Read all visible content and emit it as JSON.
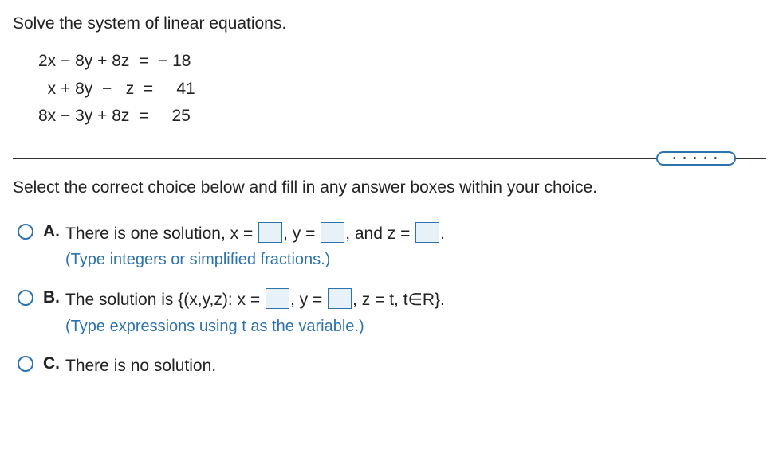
{
  "questionPrompt": "Solve the system of linear equations.",
  "equations": {
    "row1": "2x − 8y + 8z  =  − 18",
    "row2": "  x + 8y  −   z  =     41",
    "row3": "8x − 3y + 8z  =     25"
  },
  "selectPrompt": "Select the correct choice below and fill in any answer boxes within your choice.",
  "choices": {
    "A": {
      "letter": "A.",
      "part1": "There is one solution, x =",
      "part2": ", y =",
      "part3": ", and z =",
      "part4": ".",
      "hint": "(Type integers or simplified fractions.)"
    },
    "B": {
      "letter": "B.",
      "part1": "The solution is {(x,y,z): x =",
      "part2": ", y =",
      "part3": ", z = t, t∈R}.",
      "hint": "(Type expressions using t as the variable.)"
    },
    "C": {
      "letter": "C.",
      "text": "There is no solution."
    }
  }
}
